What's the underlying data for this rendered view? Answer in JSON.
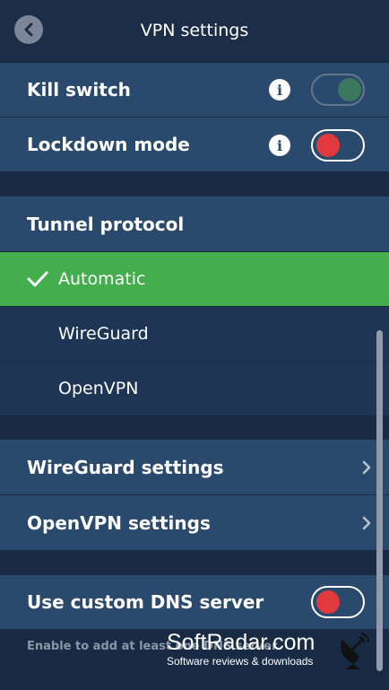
{
  "header": {
    "title": "VPN settings",
    "back_icon": "chevron-left-icon"
  },
  "kill_switch": {
    "label": "Kill switch",
    "info": "i",
    "enabled": true,
    "toggle_color": "#3d7f5a",
    "disabled": true
  },
  "lockdown_mode": {
    "label": "Lockdown mode",
    "info": "i",
    "enabled": false,
    "toggle_color": "#e03a3e"
  },
  "tunnel_protocol": {
    "title": "Tunnel protocol",
    "options": [
      {
        "label": "Automatic",
        "selected": true
      },
      {
        "label": "WireGuard",
        "selected": false
      },
      {
        "label": "OpenVPN",
        "selected": false
      }
    ]
  },
  "wireguard_settings": {
    "label": "WireGuard settings"
  },
  "openvpn_settings": {
    "label": "OpenVPN settings"
  },
  "custom_dns": {
    "label": "Use custom DNS server",
    "enabled": false,
    "toggle_color": "#e03a3e",
    "note": "Enable to add at least one DNS server."
  },
  "watermark": {
    "name": "SoftRadar.com",
    "tagline": "Software reviews & downloads"
  },
  "colors": {
    "accent_green": "#44ad4d",
    "row_bg": "#2a4a6d",
    "sub_bg": "#1e3555",
    "bg": "#192b44"
  }
}
